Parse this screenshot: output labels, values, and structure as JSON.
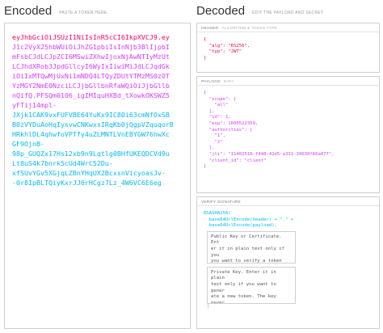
{
  "encoded": {
    "title": "Encoded",
    "hint": "PASTE A TOKEN HERE",
    "header_lines": [
      "eyJhbGciOiJSUzI1NiIsInR5cCI6IkpXVCJ9.ey"
    ],
    "payload_lines": [
      "J1c2VyX25hbWUiOiJhZG1pbiIsInNjb3BlIjpbI",
      "mFsbCJdLCJpZCI6MSwiZXhwIjoxNjAwNTIyMzUt",
      "LCJhdXRob3JpdGllcyI6WyIxIiwiMiJdLCJqdGk",
      "iOiIxMTQwMjUxNi1mNDQ4LTQyZDUtYTMzMS0zOT",
      "YzMGY2NmE0NzciLCJjbGllbnRfaWQiOiJjbGllb",
      "nQifQ.PFSQm0106_igIMIquHXBd_tXowkOKSWZ5",
      "yFTij14mpl-"
    ],
    "sig_lines": [
      "JXjk1CAK9vxFUFVBE64YuKx9IC80i63cmNfOxSB",
      "B0zVYDuAoHqIysvwCNKwxsIRqKb0jQgpVZquqorB",
      "HRkhlDL4qhwfoVPTfy4uZLMNTLVnEBYGW76hwXc",
      "GF9OjnB-",
      "98p_GUQZx17Hs12xb9n9Lqtlg0BHfUKEQDCVd9u",
      "Lt8uS4k7bnrk5cUd4WrC52Du-",
      "xfSUvYGv5XGjqLZBnYHqUX2BcxsnVicyoasJv-",
      "-0r8IpBLTQiyKxrJJ6rHCgz7Lz_4W6VC6E6eg"
    ]
  },
  "decoded": {
    "title": "Decoded",
    "hint": "EDIT THE PAYLOAD AND SECRET",
    "header_panel": {
      "title": "HEADER:",
      "sub": "ALGORITHM & TOKEN TYPE",
      "lines": [
        "{",
        "  \"alg\": \"RS256\",",
        "  \"typ\": \"JWT\"",
        "}"
      ]
    },
    "payload_panel": {
      "title": "PAYLOAD:",
      "sub": "DATA",
      "lines": [
        "{",
        "  \"scope\": [",
        "    \"all\"",
        "  ],",
        "  \"id\": 1,",
        "  \"exp\": 1600522359,",
        "  \"authorities\": [",
        "    \"1\",",
        "    \"2\"",
        "  ],",
        "  \"jti\": \"11402516-f448-42d5-a331-39630f66a477\",",
        "  \"client_id\": \"client\"",
        "}"
      ]
    },
    "signature_panel": {
      "title": "VERIFY SIGNATURE",
      "fn": "RSASHA256(",
      "line1": "  base64UrlEncode(header) + \".\" +",
      "line2": "  base64UrlEncode(payload),",
      "public_key": "Public Key or Certificate. Ent\ner it in plain text only if you\nyou want to verify a token",
      "private_key": "Private Key. Enter it in plain\ntext only if you want to gener\nate a new token. The key never\nleaves your browser.",
      "close": ")"
    }
  },
  "colors": {
    "header": "#fb015b",
    "payload": "#d63aff",
    "signature": "#00b9f1"
  }
}
